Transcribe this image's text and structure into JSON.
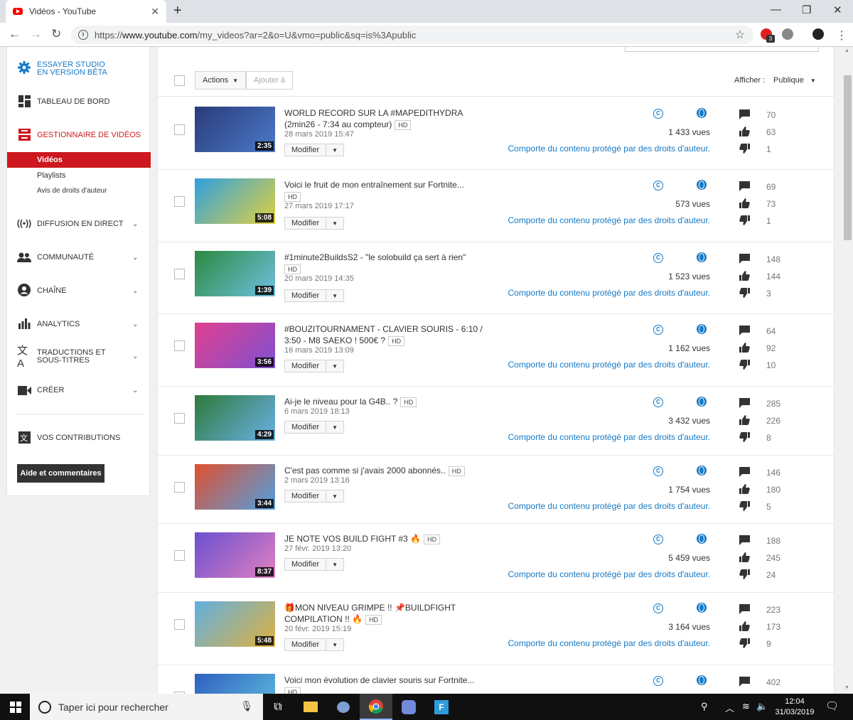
{
  "browser": {
    "tab_title": "Vidéos - YouTube",
    "new_tab": "+",
    "url_base": "https://",
    "url_host": "www.youtube.com",
    "url_path": "/my_videos?ar=2&o=U&vmo=public&sq=is%3Apublic",
    "ext_badge": "3"
  },
  "sidebar": {
    "studio": "ESSAYER STUDIO EN VERSION BÊTA",
    "dashboard": "TABLEAU DE BORD",
    "video_manager": "GESTIONNAIRE DE VIDÉOS",
    "videos": "Vidéos",
    "playlists": "Playlists",
    "copyright_notices": "Avis de droits d'auteur",
    "live": "DIFFUSION EN DIRECT",
    "community": "COMMUNAUTÉ",
    "channel": "CHAÎNE",
    "analytics": "ANALYTICS",
    "translations": "TRADUCTIONS ET SOUS-TITRES",
    "create": "CRÉER",
    "contributions": "VOS CONTRIBUTIONS",
    "help": "Aide et commentaires"
  },
  "toolbar": {
    "actions": "Actions",
    "add_to": "Ajouter à",
    "show_label": "Afficher :",
    "show_value": "Publique"
  },
  "labels": {
    "modify": "Modifier",
    "copyright": "Comporte du contenu protégé par des droits d'auteur.",
    "hd": "HD"
  },
  "videos": [
    {
      "title": "WORLD RECORD SUR LA #MAPEDITHYDRA (2min26 - 7:34 au compteur)",
      "date": "28 mars 2019 15:47",
      "duration": "2:35",
      "views": "1 433 vues",
      "comments": "70",
      "likes": "63",
      "dislikes": "1"
    },
    {
      "title": "Voici le fruit de mon entraînement sur Fortnite...",
      "date": "27 mars 2019 17:17",
      "duration": "5:08",
      "views": "573 vues",
      "comments": "69",
      "likes": "73",
      "dislikes": "1"
    },
    {
      "title": "#1minute2BuildsS2 - \"le solobuild ça sert à rien\"",
      "date": "20 mars 2019 14:35",
      "duration": "1:39",
      "views": "1 523 vues",
      "comments": "148",
      "likes": "144",
      "dislikes": "3"
    },
    {
      "title": "#BOUZITOURNAMENT - CLAVIER SOURIS - 6:10 / 3:50 - M8 SAEKO ! 500€ ?",
      "date": "16 mars 2019 13:09",
      "duration": "3:56",
      "views": "1 162 vues",
      "comments": "64",
      "likes": "92",
      "dislikes": "10"
    },
    {
      "title": "Ai-je le niveau pour la G4B.. ?",
      "date": "6 mars 2019 18:13",
      "duration": "4:29",
      "views": "3 432 vues",
      "comments": "285",
      "likes": "226",
      "dislikes": "8"
    },
    {
      "title": "C'est pas comme si j'avais 2000 abonnés..",
      "date": "2 mars 2019 13:16",
      "duration": "3:44",
      "views": "1 754 vues",
      "comments": "146",
      "likes": "180",
      "dislikes": "5"
    },
    {
      "title": "JE NOTE VOS BUILD FIGHT #3 🔥",
      "date": "27 févr. 2019 13:20",
      "duration": "8:37",
      "views": "5 459 vues",
      "comments": "188",
      "likes": "245",
      "dislikes": "24"
    },
    {
      "title": "🎁MON NIVEAU GRIMPE !! 📌BUILDFIGHT COMPILATION !! 🔥",
      "date": "20 févr. 2019 15:19",
      "duration": "5:48",
      "views": "3 164 vues",
      "comments": "223",
      "likes": "173",
      "dislikes": "9"
    },
    {
      "title": "Voici mon évolution de clavier souris sur Fortnite...",
      "comments": "402"
    }
  ],
  "taskbar": {
    "search": "Taper ici pour rechercher",
    "time": "12:04",
    "date": "31/03/2019"
  },
  "colors": {
    "accent_red": "#cc181e",
    "link_blue": "#167ac6"
  }
}
